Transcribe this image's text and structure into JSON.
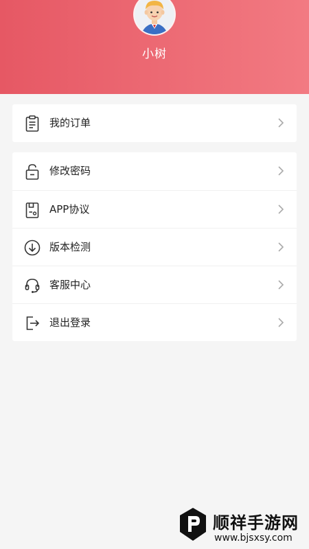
{
  "profile": {
    "username": "小树",
    "avatar_icon": "cartoon-boy-avatar"
  },
  "colors": {
    "header_start": "#e65864",
    "header_end": "#f27a82",
    "background": "#f5f5f5"
  },
  "menu": {
    "orders": {
      "label": "我的订单",
      "icon": "clipboard-icon"
    },
    "change_password": {
      "label": "修改密码",
      "icon": "unlock-icon"
    },
    "app_agreement": {
      "label": "APP协议",
      "icon": "document-icon"
    },
    "version_check": {
      "label": "版本检测",
      "icon": "download-circle-icon"
    },
    "customer_service": {
      "label": "客服中心",
      "icon": "headset-icon"
    },
    "logout": {
      "label": "退出登录",
      "icon": "logout-icon"
    }
  },
  "watermark": {
    "name": "顺祥手游网",
    "url": "www.bjsxsy.com"
  }
}
